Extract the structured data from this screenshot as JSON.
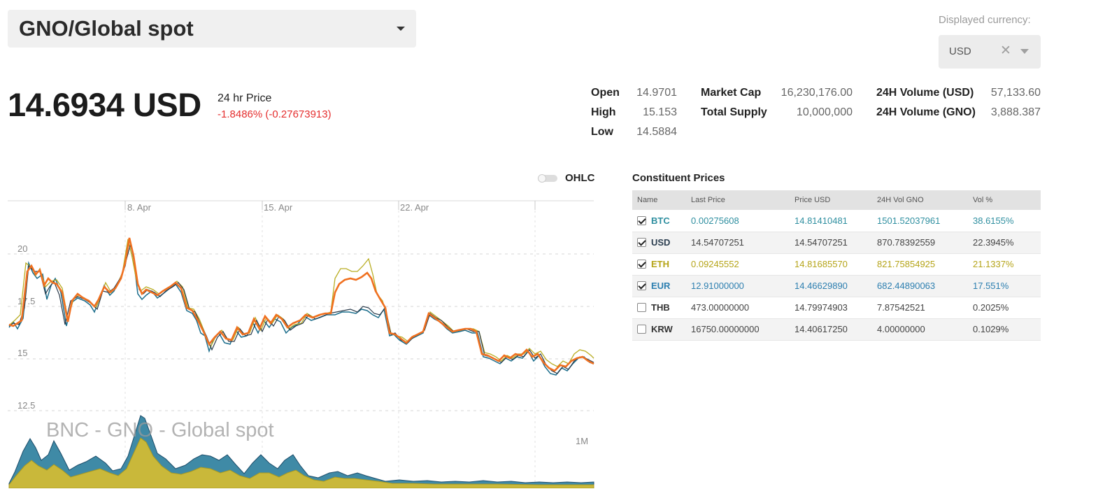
{
  "pair_selector": {
    "label": "GNO/Global spot"
  },
  "currency": {
    "label": "Displayed currency:",
    "value": "USD"
  },
  "price": {
    "value": "14.6934 USD",
    "label": "24 hr Price",
    "change": "-1.8486% (-0.27673913)",
    "change_color": "#e52f2f"
  },
  "stats": {
    "open_label": "Open",
    "open": "14.9701",
    "high_label": "High",
    "high": "15.153",
    "low_label": "Low",
    "low": "14.5884",
    "mcap_label": "Market Cap",
    "mcap": "16,230,176.00",
    "supply_label": "Total Supply",
    "supply": "10,000,000",
    "vol_usd_label": "24H Volume (USD)",
    "vol_usd": "57,133.60",
    "vol_gno_label": "24H Volume (GNO)",
    "vol_gno": "3,888.387"
  },
  "ohlc_toggle": {
    "label": "OHLC",
    "on": false
  },
  "chart": {
    "watermark": "BNC - GNO - Global spot",
    "x_labels": [
      "8. Apr",
      "15. Apr",
      "22. Apr"
    ],
    "y_labels": [
      "20",
      "17.5",
      "15",
      "12.5"
    ],
    "range_label": "1M",
    "colors": {
      "main": "#f07020",
      "btc": "#1c6e8c",
      "eth": "#b9ad23",
      "usd": "#2a3a4a",
      "volume_teal": "#3f8aa6",
      "volume_gold": "#c9b83a"
    }
  },
  "constituents": {
    "title": "Constituent Prices",
    "headers": [
      "Name",
      "Last Price",
      "Price USD",
      "24H Vol GNO",
      "Vol %"
    ],
    "rows": [
      {
        "name": "BTC",
        "checked": true,
        "last": "0.00275608",
        "usd": "14.81410481",
        "vol": "1501.52037961",
        "pct": "38.6155%",
        "color": "#2f8fa0"
      },
      {
        "name": "USD",
        "checked": true,
        "last": "14.54707251",
        "usd": "14.54707251",
        "vol": "870.78392559",
        "pct": "22.3945%",
        "color": "#2c3e50"
      },
      {
        "name": "ETH",
        "checked": true,
        "last": "0.09245552",
        "usd": "14.81685570",
        "vol": "821.75854925",
        "pct": "21.1337%",
        "color": "#b5a418"
      },
      {
        "name": "EUR",
        "checked": true,
        "last": "12.91000000",
        "usd": "14.46629890",
        "vol": "682.44890063",
        "pct": "17.551%",
        "color": "#2d7fb0"
      },
      {
        "name": "THB",
        "checked": false,
        "last": "473.00000000",
        "usd": "14.79974903",
        "vol": "7.87542521",
        "pct": "0.2025%",
        "color": "#333333"
      },
      {
        "name": "KRW",
        "checked": false,
        "last": "16750.00000000",
        "usd": "14.40617250",
        "vol": "4.00000000",
        "pct": "0.1029%",
        "color": "#333333"
      }
    ]
  }
}
